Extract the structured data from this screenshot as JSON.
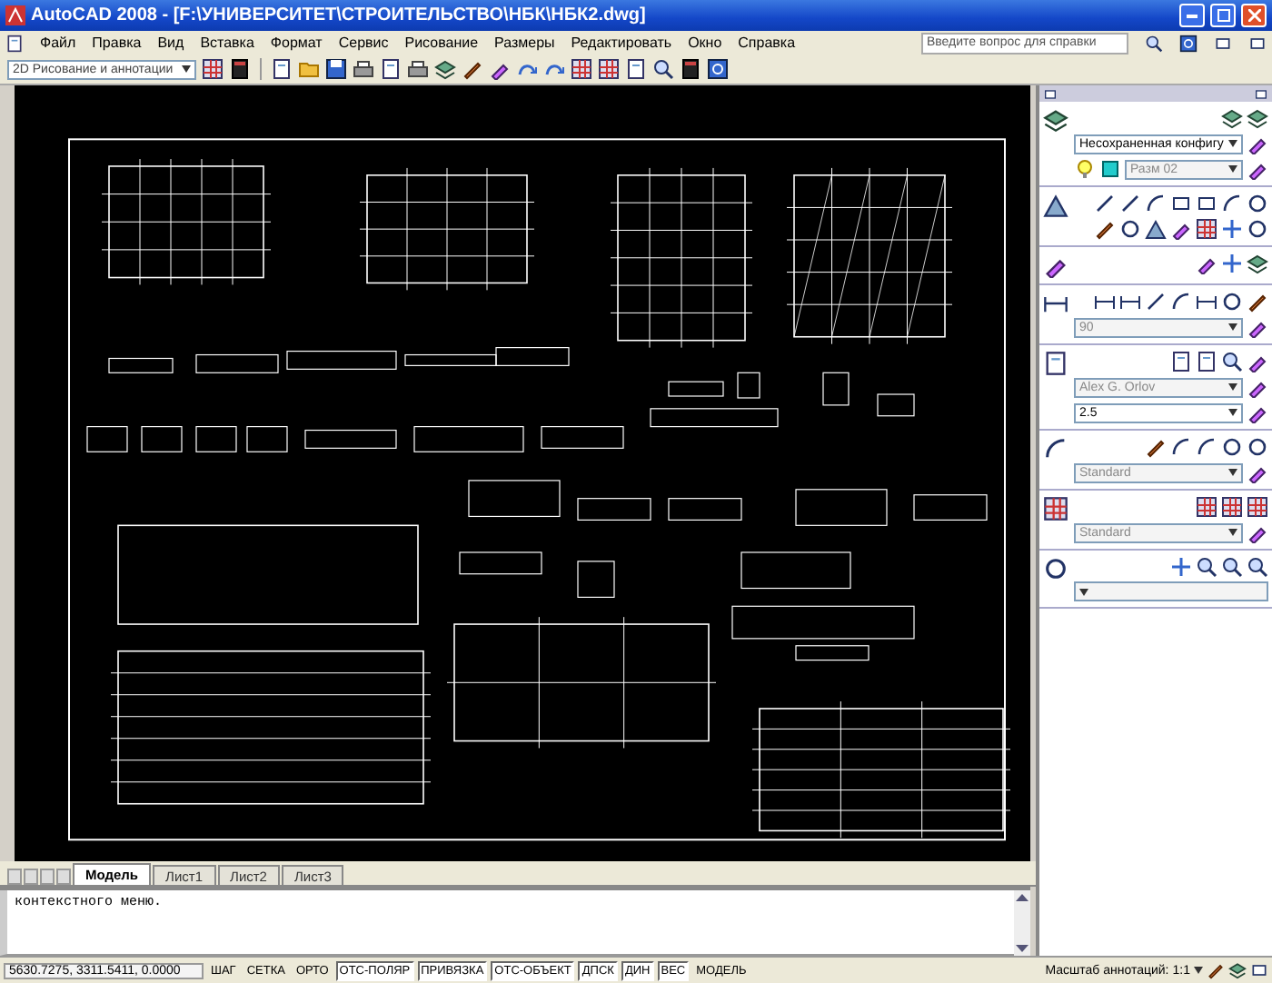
{
  "window": {
    "title": "AutoCAD 2008 - [F:\\УНИВЕРСИТЕТ\\СТРОИТЕЛЬСТВО\\НБК\\НБК2.dwg]"
  },
  "menu": [
    "Файл",
    "Правка",
    "Вид",
    "Вставка",
    "Формат",
    "Сервис",
    "Рисование",
    "Размеры",
    "Редактировать",
    "Окно",
    "Справка"
  ],
  "help_search": {
    "placeholder": "Введите вопрос для справки"
  },
  "workspace": {
    "value": "2D Рисование и аннотации"
  },
  "palette": {
    "sections": [
      {
        "kind": "layers",
        "dropdowns": [
          {
            "value": "Несохраненная конфигу",
            "disabled": false
          },
          {
            "value": "Разм 02",
            "disabled": true
          }
        ]
      },
      {
        "kind": "draw"
      },
      {
        "kind": "modify"
      },
      {
        "kind": "dimension",
        "dropdowns": [
          {
            "value": "90",
            "disabled": true
          }
        ]
      },
      {
        "kind": "text",
        "dropdowns": [
          {
            "value": "Alex G. Orlov",
            "disabled": true
          },
          {
            "value": "2.5",
            "disabled": false
          }
        ]
      },
      {
        "kind": "multileader",
        "dropdowns": [
          {
            "value": "Standard",
            "disabled": true
          }
        ]
      },
      {
        "kind": "table",
        "dropdowns": [
          {
            "value": "Standard",
            "disabled": true
          }
        ]
      },
      {
        "kind": "navigate"
      }
    ]
  },
  "layout_tabs": [
    {
      "label": "Модель",
      "selected": true
    },
    {
      "label": "Лист1",
      "selected": false
    },
    {
      "label": "Лист2",
      "selected": false
    },
    {
      "label": "Лист3",
      "selected": false
    }
  ],
  "command_line": {
    "text": "контекстного меню."
  },
  "status_bar": {
    "coordinates": "5630.7275, 3311.5411, 0.0000",
    "toggles": [
      {
        "label": "ШАГ",
        "on": false
      },
      {
        "label": "СЕТКА",
        "on": false
      },
      {
        "label": "ОРТО",
        "on": false
      },
      {
        "label": "ОТС-ПОЛЯР",
        "on": true
      },
      {
        "label": "ПРИВЯЗКА",
        "on": true
      },
      {
        "label": "ОТС-ОБЪЕКТ",
        "on": true
      },
      {
        "label": "ДПСК",
        "on": true
      },
      {
        "label": "ДИН",
        "on": true
      },
      {
        "label": "ВЕС",
        "on": true
      },
      {
        "label": "МОДЕЛЬ",
        "on": false
      }
    ],
    "annotation_scale_label": "Масштаб аннотаций:",
    "annotation_scale": "1:1"
  }
}
